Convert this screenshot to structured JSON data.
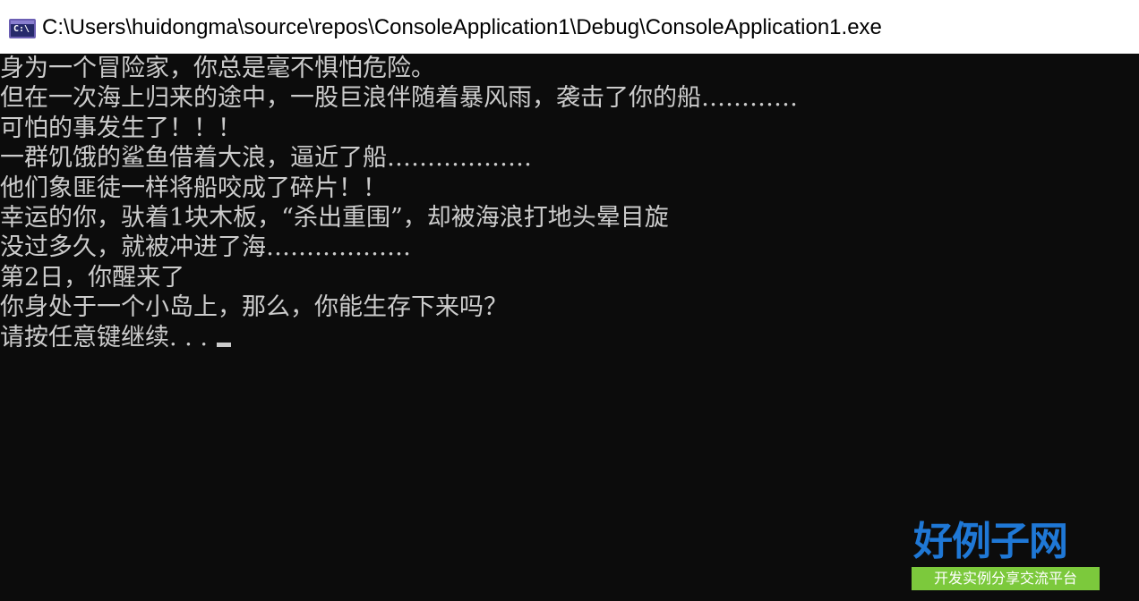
{
  "window": {
    "title": "C:\\Users\\huidongma\\source\\repos\\ConsoleApplication1\\Debug\\ConsoleApplication1.exe",
    "icon": "console-app-icon",
    "icon_glyph": "C:\\"
  },
  "console": {
    "background": "#0c0c0c",
    "foreground": "#cccccc",
    "lines": [
      "身为一个冒险家，你总是毫不惧怕危险。",
      "但在一次海上归来的途中，一股巨浪伴随着暴风雨，袭击了你的船…………",
      "可怕的事发生了！！！",
      "一群饥饿的鲨鱼借着大浪，逼近了船………………",
      "他们象匪徒一样将船咬成了碎片！！",
      "幸运的你，驮着1块木板，“杀出重围”，却被海浪打地头晕目旋",
      "没过多久，就被冲进了海………………",
      "第2日，你醒来了",
      "你身处于一个小岛上，那么，你能生存下来吗？",
      "请按任意键继续. . ."
    ]
  },
  "watermark": {
    "title": "好例子网",
    "subtitle": "开发实例分享交流平台",
    "title_color": "#1f78d6",
    "subtitle_bg": "#7cc93c"
  }
}
